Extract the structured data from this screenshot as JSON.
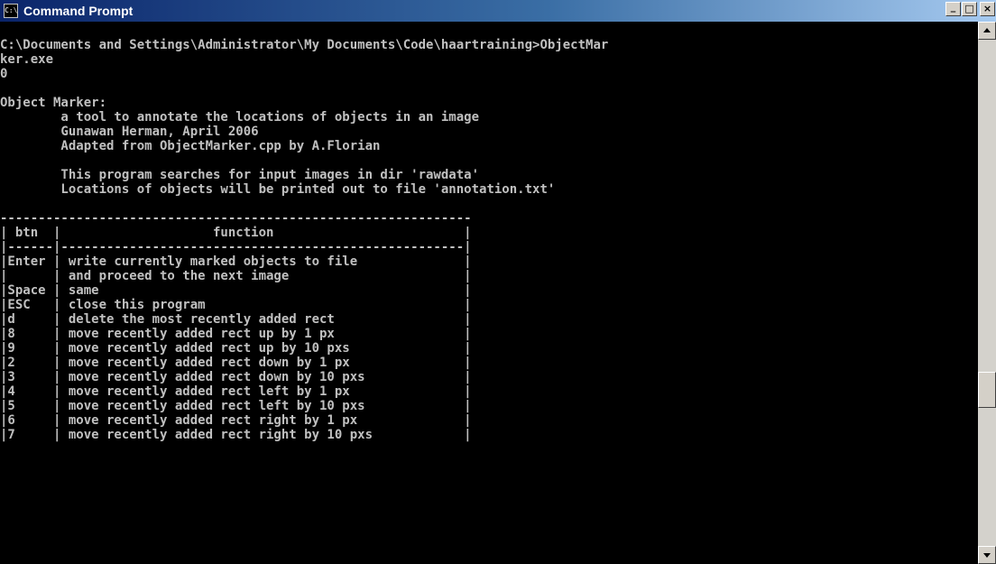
{
  "window": {
    "title": "Command Prompt",
    "icon_label": "C:\\",
    "minimize_label": "_",
    "maximize_label": "□",
    "close_label": "×"
  },
  "console": {
    "lines": [
      "",
      "C:\\Documents and Settings\\Administrator\\My Documents\\Code\\haartraining>ObjectMar",
      "ker.exe",
      "0",
      "",
      "Object Marker:",
      "        a tool to annotate the locations of objects in an image",
      "        Gunawan Herman, April 2006",
      "        Adapted from ObjectMarker.cpp by A.Florian",
      "",
      "        This program searches for input images in dir 'rawdata'",
      "        Locations of objects will be printed out to file 'annotation.txt'",
      "",
      "--------------------------------------------------------------",
      "| btn  |                    function                         |",
      "|------|-----------------------------------------------------|",
      "|Enter | write currently marked objects to file              |",
      "|      | and proceed to the next image                       |",
      "|Space | same                                                |",
      "|ESC   | close this program                                  |",
      "|d     | delete the most recently added rect                 |",
      "|8     | move recently added rect up by 1 px                 |",
      "|9     | move recently added rect up by 10 pxs               |",
      "|2     | move recently added rect down by 1 px               |",
      "|3     | move recently added rect down by 10 pxs             |",
      "|4     | move recently added rect left by 1 px               |",
      "|5     | move recently added rect left by 10 pxs             |",
      "|6     | move recently added rect right by 1 px              |",
      "|7     | move recently added rect right by 10 pxs            |"
    ]
  },
  "colors": {
    "console_bg": "#000000",
    "console_text": "#c0c0c0",
    "titlebar_start": "#0a246a",
    "titlebar_end": "#a6caf0"
  },
  "icons": {
    "window_icon": "cmd-icon",
    "scroll_up": "arrow-up-icon",
    "scroll_down": "arrow-down-icon"
  }
}
